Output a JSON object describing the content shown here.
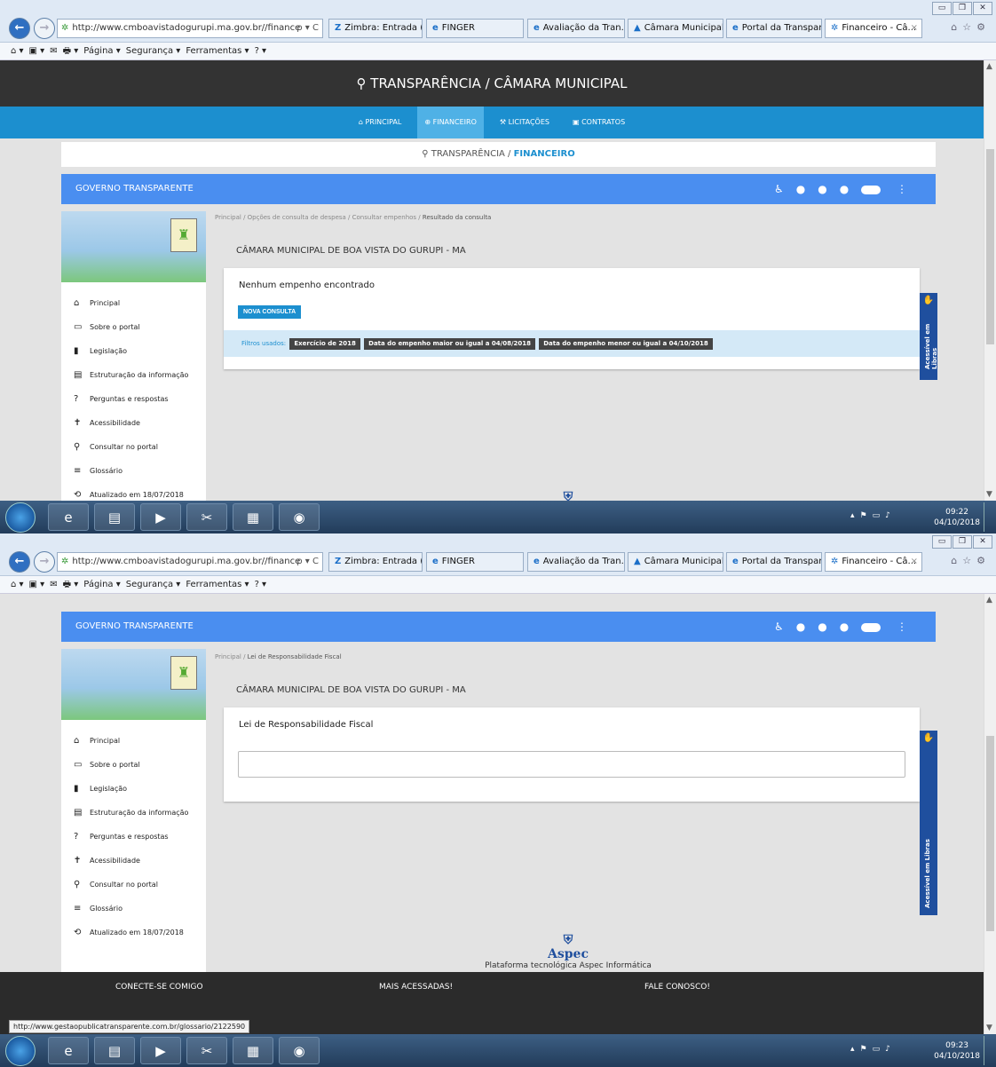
{
  "browser": {
    "url": "http://www.cmboavistadogurupi.ma.gov.br//finance",
    "search_ctl": "ρ ▾ C",
    "tabs": [
      {
        "label": "Zimbra: Entrada (8)",
        "icon": "zimbra-icon"
      },
      {
        "label": "FINGER",
        "icon": "ie-icon"
      },
      {
        "label": "Avaliação da Tran...",
        "icon": "ie-icon"
      },
      {
        "label": "Câmara Municipal...",
        "icon": "camara-icon"
      },
      {
        "label": "Portal da Transpar...",
        "icon": "ie-icon"
      },
      {
        "label": "Financeiro - Câ...",
        "icon": "portal-icon"
      }
    ],
    "tab_close": "×",
    "tools": "⌂☆⚙",
    "cmd": [
      "⌂ ▾",
      "▣ ▾",
      "✉",
      "🖶 ▾",
      "Página ▾",
      "Segurança ▾",
      "Ferramentas ▾",
      "? ▾"
    ]
  },
  "site": {
    "top_title": "TRANSPARÊNCIA / CÂMARA MUNICIPAL",
    "nav": [
      "PRINCIPAL",
      "FINANCEIRO",
      "LICITAÇÕES",
      "CONTRATOS"
    ],
    "crumb_prefix": "TRANSPARÊNCIA / ",
    "crumb_section": "FINANCEIRO",
    "gov_bar": "GOVERNO TRANSPARENTE",
    "org": "CÂMARA MUNICIPAL DE BOA VISTA DO GURUPI - MA",
    "menu": [
      {
        "label": "Principal",
        "icon": "⌂"
      },
      {
        "label": "Sobre o portal",
        "icon": "▭"
      },
      {
        "label": "Legislação",
        "icon": "▮"
      },
      {
        "label": "Estruturação da informação",
        "icon": "▤"
      },
      {
        "label": "Perguntas e respostas",
        "icon": "?"
      },
      {
        "label": "Acessibilidade",
        "icon": "✝"
      },
      {
        "label": "Consultar no portal",
        "icon": "⚲"
      },
      {
        "label": "Glossário",
        "icon": "≡"
      },
      {
        "label": "Atualizado em 18/07/2018",
        "icon": "⟲"
      }
    ],
    "libras": "Acessível em Libras",
    "aspec_name": "Aspec",
    "aspec_caption": "Plataforma tecnológica Aspec Informática"
  },
  "shot1": {
    "crumbs": [
      "Principal",
      "Opções de consulta de despesa",
      "Consultar empenhos",
      "Resultado da consulta"
    ],
    "message": "Nenhum empenho encontrado",
    "new_query": "NOVA CONSULTA",
    "filters_label": "Filtros usados:",
    "filters": [
      "Exercício de 2018",
      "Data do empenho maior ou igual a 04/08/2018",
      "Data do empenho menor ou igual a 04/10/2018"
    ],
    "time": "09:22",
    "date": "04/10/2018"
  },
  "shot2": {
    "crumbs": [
      "Principal",
      "Lei de Responsabilidade Fiscal"
    ],
    "content_title": "Lei de Responsabilidade Fiscal",
    "footer": [
      "CONECTE-SE COMIGO",
      "MAIS ACESSADAS!",
      "FALE CONOSCO!"
    ],
    "status_url": "http://www.gestaopublicatransparente.com.br/glossario/2122590",
    "time": "09:23",
    "date": "04/10/2018"
  }
}
